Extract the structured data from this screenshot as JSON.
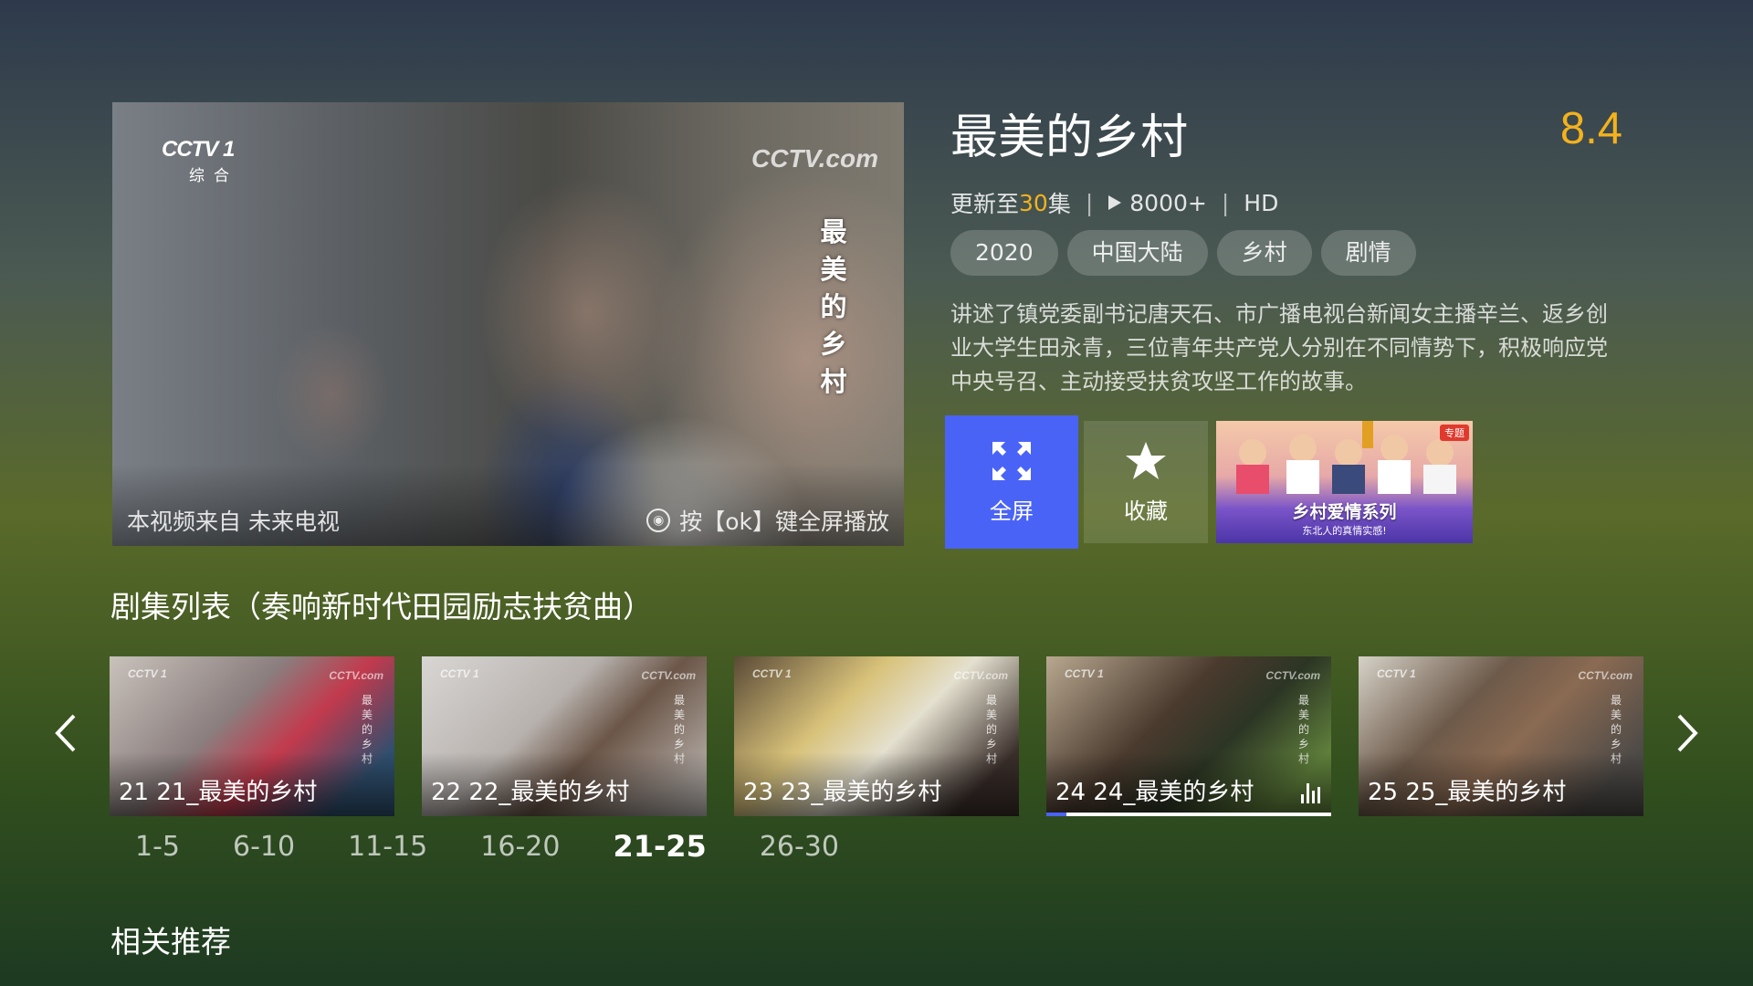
{
  "player": {
    "channel_logo": "CCTV 1",
    "channel_sub": "综合",
    "watermark": "CCTV.com",
    "vertical_title": "最美的乡村",
    "source_text": "本视频来自 未来电视",
    "ok_hint": "按【ok】键全屏播放"
  },
  "show": {
    "title": "最美的乡村",
    "rating": "8.4",
    "update_prefix": "更新至",
    "update_count": "30",
    "update_suffix": "集",
    "plays": "8000+",
    "quality": "HD",
    "tags": [
      "2020",
      "中国大陆",
      "乡村",
      "剧情"
    ],
    "description": "讲述了镇党委副书记唐天石、市广播电视台新闻女主播辛兰、返乡创业大学生田永青，三位青年共产党人分别在不同情势下，积极响应党中央号召、主动接受扶贫攻坚工作的故事。"
  },
  "actions": {
    "fullscreen_label": "全屏",
    "favorite_label": "收藏",
    "promo_title": "乡村爱情系列",
    "promo_subtitle": "东北人的真情实感!",
    "promo_badge": "专题"
  },
  "episodes_section": {
    "title": "剧集列表（奏响新时代田园励志扶贫曲）",
    "items": [
      {
        "label": "21 21_最美的乡村"
      },
      {
        "label": "22 22_最美的乡村"
      },
      {
        "label": "23 23_最美的乡村"
      },
      {
        "label": "24 24_最美的乡村",
        "playing": true,
        "progress": 0.07
      },
      {
        "label": "25 25_最美的乡村"
      }
    ],
    "ranges": [
      "1-5",
      "6-10",
      "11-15",
      "16-20",
      "21-25",
      "26-30"
    ],
    "active_range": "21-25"
  },
  "related_title": "相关推荐",
  "colors": {
    "accent": "#4a63f7",
    "rating": "#f3b21d"
  }
}
